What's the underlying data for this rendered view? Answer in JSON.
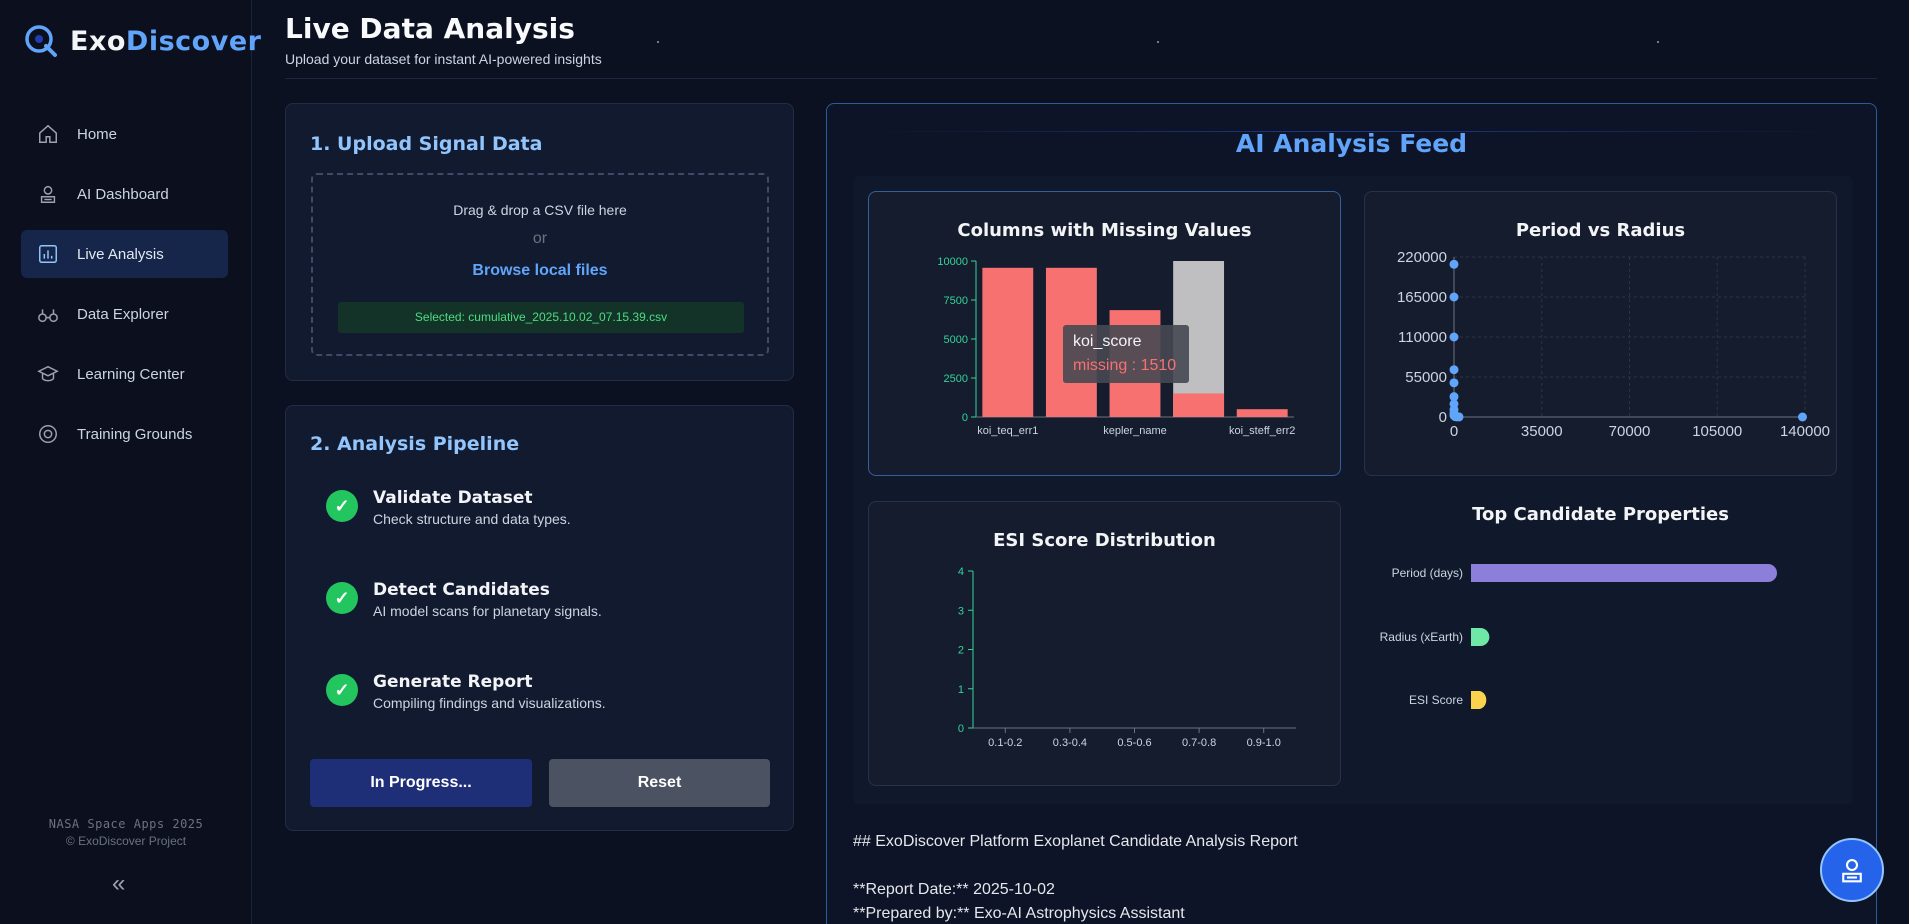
{
  "brand": {
    "part1": "Exo",
    "part2": "Discover"
  },
  "nav": [
    {
      "label": "Home",
      "icon": "home-icon"
    },
    {
      "label": "AI Dashboard",
      "icon": "ai-dashboard-icon"
    },
    {
      "label": "Live Analysis",
      "icon": "chart-icon",
      "active": true
    },
    {
      "label": "Data Explorer",
      "icon": "binoculars-icon"
    },
    {
      "label": "Learning Center",
      "icon": "graduation-cap-icon"
    },
    {
      "label": "Training Grounds",
      "icon": "target-icon"
    }
  ],
  "footer": {
    "line1": "NASA Space Apps 2025",
    "line2": "© ExoDiscover Project"
  },
  "header": {
    "title": "Live Data Analysis",
    "subtitle": "Upload your dataset for instant AI-powered insights"
  },
  "upload": {
    "title": "1. Upload Signal Data",
    "drag_text": "Drag & drop a CSV file here",
    "or_text": "or",
    "browse_label": "Browse local files",
    "selected_text": "Selected: cumulative_2025.10.02_07.15.39.csv"
  },
  "pipeline": {
    "title": "2. Analysis Pipeline",
    "steps": [
      {
        "title": "Validate Dataset",
        "desc": "Check structure and data types."
      },
      {
        "title": "Detect Candidates",
        "desc": "AI model scans for planetary signals."
      },
      {
        "title": "Generate Report",
        "desc": "Compiling findings and visualizations."
      }
    ],
    "progress_label": "In Progress...",
    "reset_label": "Reset"
  },
  "feed": {
    "title": "AI Analysis Feed"
  },
  "colors": {
    "accent": "#60a5fa",
    "success": "#22c55e",
    "bar_red": "#f87171",
    "bar_purple": "#8b7fd9",
    "bar_green": "#6ee7a7",
    "bar_yellow": "#fcd34d"
  },
  "chart_data": [
    {
      "type": "bar",
      "title": "Columns with Missing Values",
      "categories": [
        "koi_teq_err1",
        "",
        "kepler_name",
        "koi_score",
        "koi_steff_err2"
      ],
      "x_tick_labels": [
        "koi_teq_err1",
        "kepler_name",
        "koi_steff_err2"
      ],
      "values": [
        9564,
        9564,
        6850,
        1510,
        500
      ],
      "highlight": {
        "index": 3,
        "color": "#d1d1d1",
        "highlight_value": 10000
      },
      "yticks": [
        0,
        2500,
        5000,
        7500,
        10000
      ],
      "ylim": [
        0,
        10000
      ],
      "tooltip": {
        "title": "koi_score",
        "text": "missing : 1510"
      }
    },
    {
      "type": "scatter",
      "title": "Period vs Radius",
      "points": [
        [
          0,
          210000
        ],
        [
          0,
          165000
        ],
        [
          0,
          110000
        ],
        [
          0,
          65000
        ],
        [
          0,
          47000
        ],
        [
          0,
          28000
        ],
        [
          0,
          18000
        ],
        [
          0,
          10000
        ],
        [
          0,
          5000
        ],
        [
          0,
          2000
        ],
        [
          500,
          500
        ],
        [
          1000,
          200
        ],
        [
          2000,
          100
        ],
        [
          139000,
          0
        ]
      ],
      "xticks": [
        0,
        35000,
        70000,
        105000,
        140000
      ],
      "yticks": [
        0,
        55000,
        110000,
        165000,
        220000
      ],
      "xlim": [
        0,
        140000
      ],
      "ylim": [
        0,
        220000
      ]
    },
    {
      "type": "bar",
      "title": "ESI Score Distribution",
      "categories": [
        "0.1-0.2",
        "0.3-0.4",
        "0.5-0.6",
        "0.7-0.8",
        "0.9-1.0"
      ],
      "values": [
        0,
        0,
        0,
        0,
        0
      ],
      "yticks": [
        0,
        1,
        2,
        3,
        4
      ],
      "ylim": [
        0,
        4
      ]
    },
    {
      "type": "bar",
      "orientation": "horizontal",
      "title": "Top Candidate Properties",
      "categories": [
        "Period (days)",
        "Radius (xEarth)",
        "ESI Score"
      ],
      "values": [
        1,
        0.06,
        0.05
      ],
      "colors": [
        "#8b7fd9",
        "#6ee7a7",
        "#fcd34d"
      ]
    }
  ],
  "report": {
    "heading": "## ExoDiscover Platform Exoplanet Candidate Analysis Report",
    "date": "**Report Date:** 2025-10-02",
    "prepared": "**Prepared by:** Exo-AI Astrophysics Assistant"
  }
}
